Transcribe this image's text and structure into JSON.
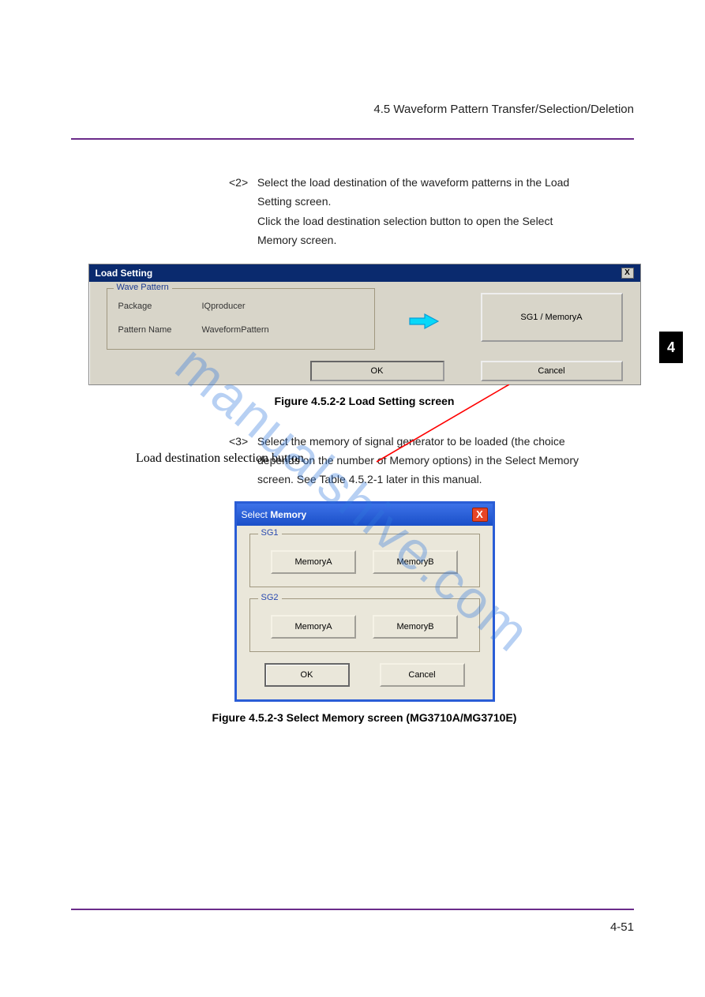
{
  "header": {
    "section": "4.5  Waveform Pattern Transfer/Selection/Deletion"
  },
  "sidebar": {
    "chapter": "4"
  },
  "footer": {
    "page": "4-51"
  },
  "watermark": "manualshive.com",
  "intro": {
    "step": "<2>",
    "line1": "Select the load destination of the waveform patterns in the Load",
    "line2": "Setting screen.",
    "line3": "Click the load destination selection button to open the Select",
    "line4": "Memory screen."
  },
  "dlg1": {
    "title": "Load Setting",
    "fieldset_legend": "Wave Pattern",
    "package_label": "Package",
    "package_value": "IQproducer",
    "pattern_label": "Pattern Name",
    "pattern_value": "WaveformPattern",
    "dest_button": "SG1 / MemoryA",
    "ok": "OK",
    "cancel": "Cancel",
    "close": "X"
  },
  "callout": {
    "label": "Load destination selection button"
  },
  "fig1_caption": "Figure 4.5.2-2   Load Setting screen",
  "mid_text": {
    "step": "<3>",
    "line1": "Select the memory of signal generator to be loaded (the choice",
    "line2": "depends on the number of Memory options) in the Select Memory",
    "line3": "screen.   See Table 4.5.2-1 later in this manual."
  },
  "dlg2": {
    "title_plain": "Select ",
    "title_bold": "Memory",
    "close": "X",
    "sg1_legend": "SG1",
    "sg2_legend": "SG2",
    "mem_a": "MemoryA",
    "mem_b": "MemoryB",
    "ok": "OK",
    "cancel": "Cancel"
  },
  "fig2_caption": "Figure 4.5.2-3   Select Memory screen (MG3710A/MG3710E)"
}
